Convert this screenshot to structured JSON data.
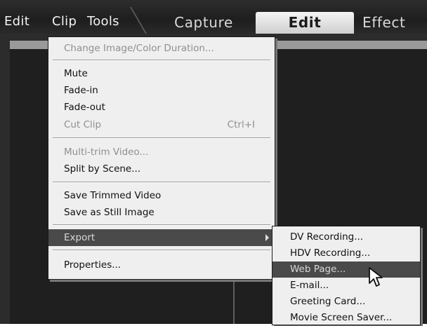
{
  "menubar": {
    "items": [
      "Edit",
      "Clip",
      "Tools"
    ]
  },
  "mode_tabs": {
    "capture": "Capture",
    "edit": "Edit",
    "effects": "Effect"
  },
  "clip_menu": {
    "change_duration": "Change Image/Color Duration...",
    "mute": "Mute",
    "fade_in": "Fade-in",
    "fade_out": "Fade-out",
    "cut_clip": "Cut Clip",
    "cut_clip_shortcut": "Ctrl+I",
    "multi_trim": "Multi-trim Video...",
    "split_by_scene": "Split by Scene...",
    "save_trimmed": "Save Trimmed Video",
    "save_still": "Save as Still Image",
    "export": "Export",
    "properties": "Properties..."
  },
  "export_submenu": {
    "items": [
      "DV Recording...",
      "HDV Recording...",
      "Web Page...",
      "E-mail...",
      "Greeting Card...",
      "Movie Screen Saver..."
    ],
    "highlighted": "Web Page..."
  },
  "icons": {
    "submenu_arrow": "chevron-right-icon",
    "cursor": "mouse-pointer-icon"
  },
  "colors": {
    "highlight": "#4a4a4a",
    "menu_bg": "#efefef",
    "disabled_text": "#8f8f8f",
    "topbar": "#2d2d2d",
    "active_tab": "#e6e6e6"
  }
}
